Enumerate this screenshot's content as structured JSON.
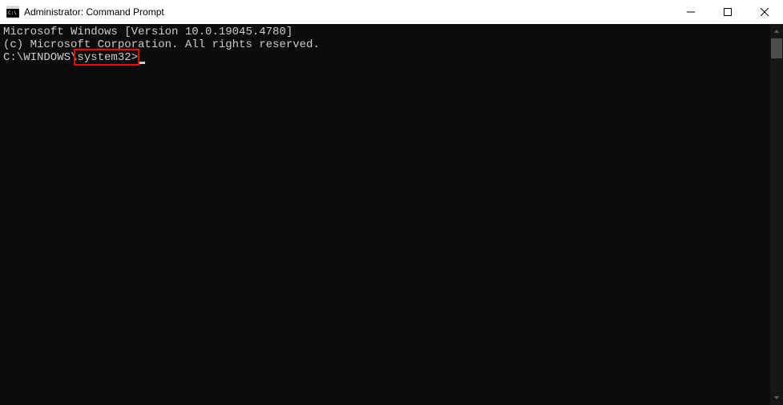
{
  "window": {
    "title": "Administrator: Command Prompt"
  },
  "terminal": {
    "line1": "Microsoft Windows [Version 10.0.19045.4780]",
    "line2": "(c) Microsoft Corporation. All rights reserved.",
    "blank": "",
    "prompt_prefix": "C:\\WINDOWS\\",
    "prompt_highlighted": "system32>"
  },
  "highlight": {
    "color": "#ff0000"
  }
}
